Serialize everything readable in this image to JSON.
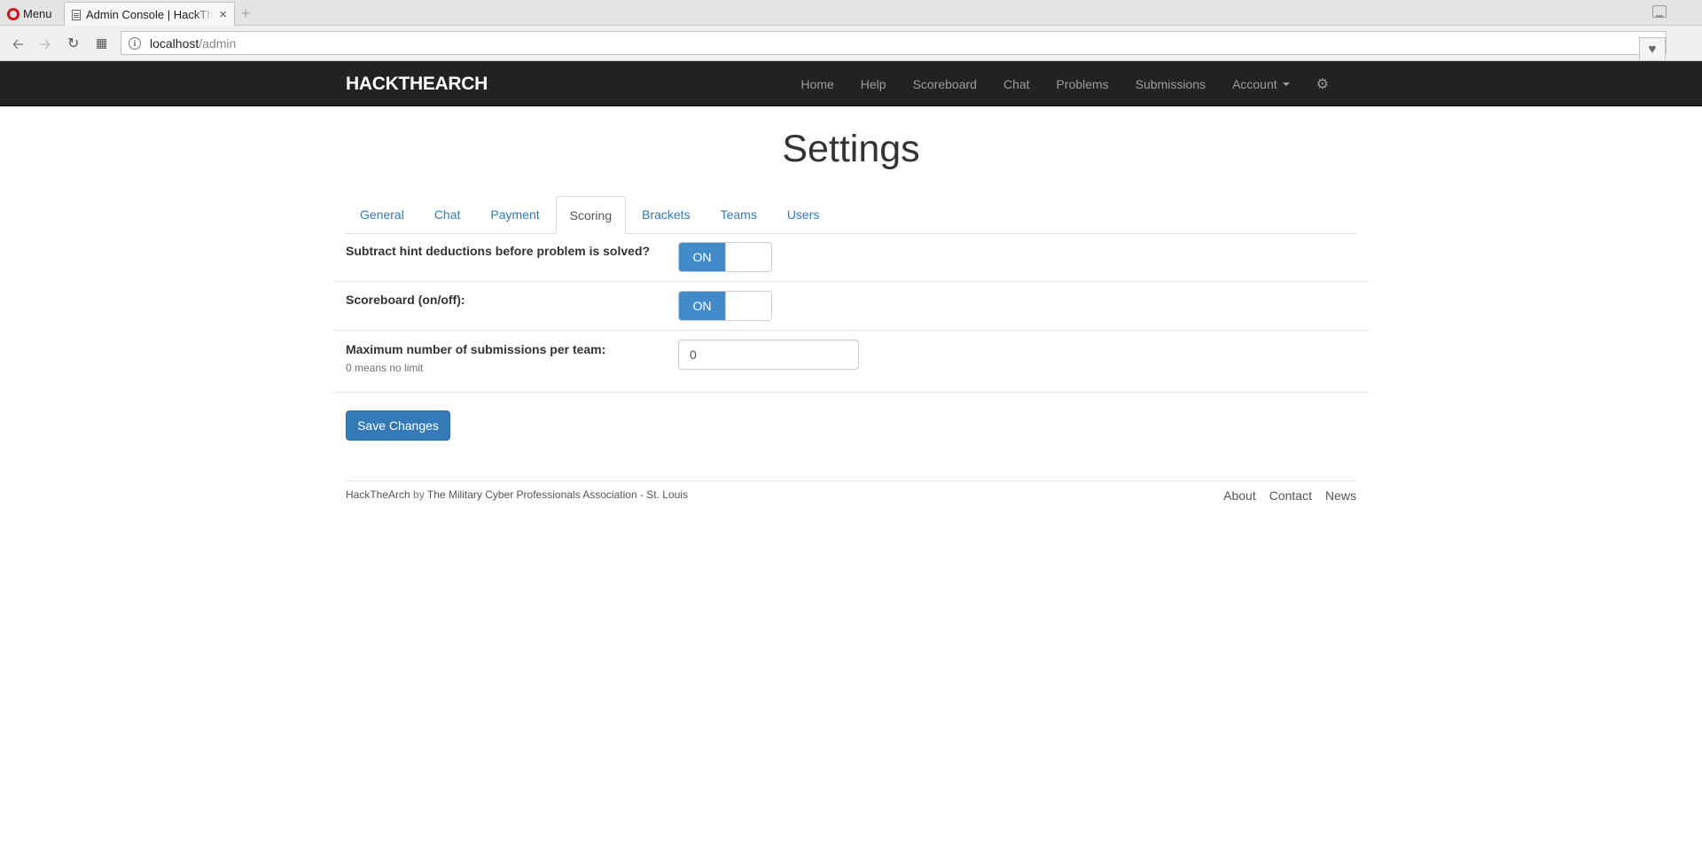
{
  "browser": {
    "menu_label": "Menu",
    "tab_title": "Admin Console | HackTheArch",
    "tab_close": "×",
    "new_tab": "+",
    "url_host": "localhost",
    "url_path": "/admin",
    "url_info": "i",
    "icons": {
      "back": "arrow-left-icon",
      "forward": "arrow-right-icon",
      "reload": "reload-icon",
      "speed_dial": "grid-icon",
      "bookmark": "heart-icon"
    }
  },
  "navbar": {
    "brand": "HACKTHEARCH",
    "links": [
      "Home",
      "Help",
      "Scoreboard",
      "Chat",
      "Problems",
      "Submissions"
    ],
    "account_label": "Account",
    "settings_icon": "gear-icon"
  },
  "page": {
    "title": "Settings",
    "tabs": [
      "General",
      "Chat",
      "Payment",
      "Scoring",
      "Brackets",
      "Teams",
      "Users"
    ],
    "active_tab": "Scoring"
  },
  "settings": {
    "hint_deductions": {
      "label": "Subtract hint deductions before problem is solved?",
      "state": "ON"
    },
    "scoreboard": {
      "label": "Scoreboard (on/off):",
      "state": "ON"
    },
    "max_submissions": {
      "label": "Maximum number of submissions per team:",
      "help": "0 means no limit",
      "value": "0"
    }
  },
  "actions": {
    "save_label": "Save Changes"
  },
  "footer": {
    "site": "HackTheArch",
    "by": "by",
    "org": "The Military Cyber Professionals Association - St. Louis",
    "links": [
      "About",
      "Contact",
      "News"
    ]
  },
  "colors": {
    "navbar_bg": "#222222",
    "primary": "#337ab7",
    "switch_on": "#428bca",
    "link": "#337ab7"
  }
}
